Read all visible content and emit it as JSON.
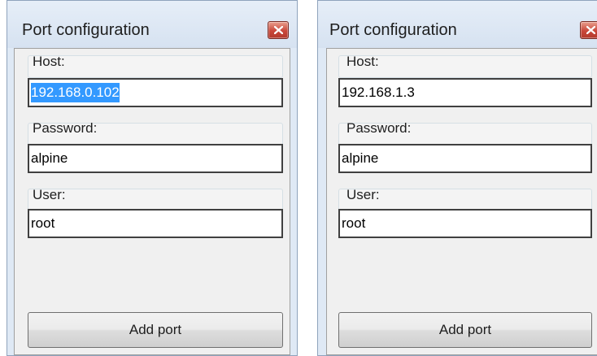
{
  "windows": [
    {
      "title": "Port configuration",
      "host_label": "Host:",
      "host_value": "192.168.0.102",
      "password_label": "Password:",
      "password_value": "alpine",
      "user_label": "User:",
      "user_value": "root",
      "add_button_label": "Add port"
    },
    {
      "title": "Port configuration",
      "host_label": "Host:",
      "host_value": "192.168.1.3",
      "password_label": "Password:",
      "password_value": "alpine",
      "user_label": "User:",
      "user_value": "root",
      "add_button_label": "Add port"
    }
  ],
  "icons": {
    "close": "close-icon"
  },
  "colors": {
    "selection": "#3399ff",
    "close_button": "#c9473a",
    "frame": "#dfe9f5"
  }
}
